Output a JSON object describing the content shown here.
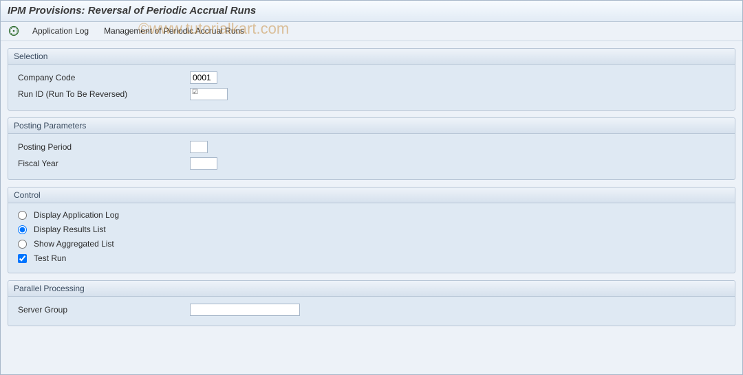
{
  "title": "IPM Provisions: Reversal of Periodic Accrual Runs",
  "toolbar": {
    "application_log": "Application Log",
    "management": "Management of Periodic Accrual Runs"
  },
  "groups": {
    "selection": {
      "title": "Selection",
      "company_code_label": "Company Code",
      "company_code_value": "0001",
      "run_id_label": "Run ID (Run To Be Reversed)",
      "run_id_value": ""
    },
    "posting": {
      "title": "Posting Parameters",
      "posting_period_label": "Posting Period",
      "posting_period_value": "",
      "fiscal_year_label": "Fiscal Year",
      "fiscal_year_value": ""
    },
    "control": {
      "title": "Control",
      "opt_app_log": "Display Application Log",
      "opt_results": "Display Results List",
      "opt_aggregated": "Show Aggregated List",
      "chk_test_run": "Test Run"
    },
    "parallel": {
      "title": "Parallel Processing",
      "server_group_label": "Server Group",
      "server_group_value": ""
    }
  },
  "watermark": "©www.tutorialkart.com"
}
